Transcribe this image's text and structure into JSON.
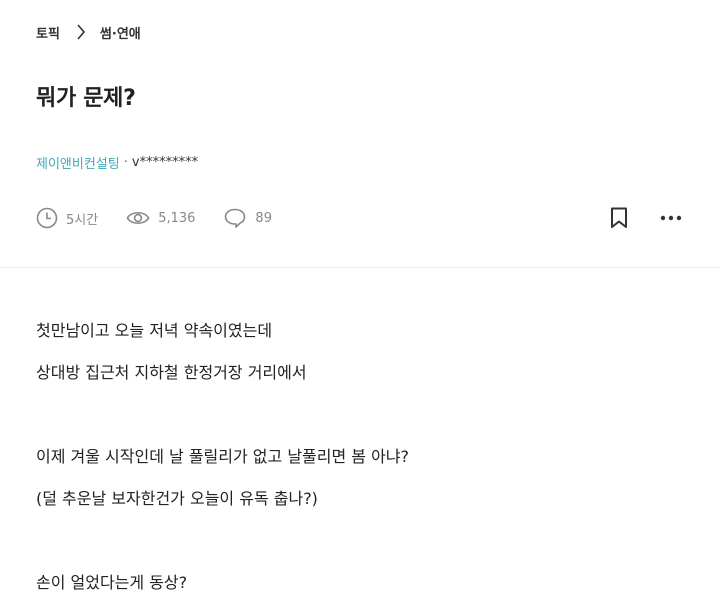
{
  "breadcrumb": {
    "root": "토픽",
    "current": "썸·연애"
  },
  "post": {
    "title": "뭐가 문제?",
    "company": "제이앤비컨설팅",
    "separator": "·",
    "username": "v*********",
    "time": "5시간",
    "views": "5,136",
    "comments": "89"
  },
  "icons": {
    "breadcrumb_separator": "chevron-right-icon",
    "time": "clock-icon",
    "views": "eye-icon",
    "comments": "comment-icon",
    "bookmark": "bookmark-icon",
    "more": "more-horizontal-icon"
  },
  "colors": {
    "accent": "#3fa9b8",
    "meta": "#888888",
    "text": "#222222"
  },
  "body": [
    "첫만남이고 오늘 저녁 약속이였는데",
    "상대방 집근처 지하철 한정거장 거리에서",
    "",
    "이제 겨울 시작인데 날 풀릴리가 없고 날풀리면 봄 아냐?",
    "(덜 추운날 보자한건가 오늘이 유독 춥나?)",
    "",
    "손이 얼었다는게 동상?"
  ]
}
